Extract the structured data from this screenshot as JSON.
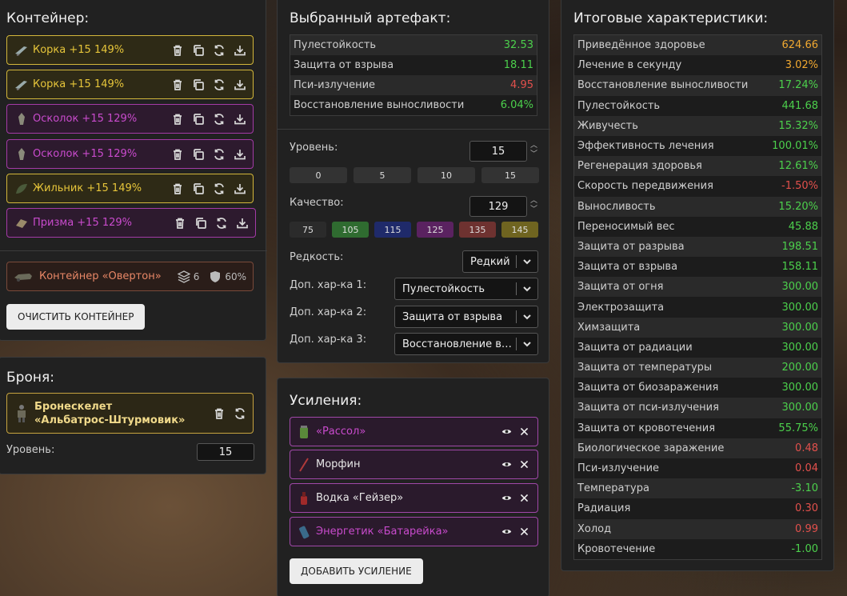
{
  "container": {
    "title": "Контейнер:",
    "items": [
      {
        "label": "Корка +15 149%",
        "color": "gold",
        "icon": "knife-icon"
      },
      {
        "label": "Корка +15 149%",
        "color": "gold",
        "icon": "knife-icon"
      },
      {
        "label": "Осколок +15 129%",
        "color": "purple",
        "icon": "shard-icon"
      },
      {
        "label": "Осколок +15 129%",
        "color": "purple",
        "icon": "shard-icon"
      },
      {
        "label": "Жильник +15 149%",
        "color": "gold",
        "icon": "leaf-icon"
      },
      {
        "label": "Призма +15 129%",
        "color": "purple",
        "icon": "prism-icon"
      }
    ],
    "container_name": "Контейнер «Овертон»",
    "slots": "6",
    "protection": "60%",
    "clear_button": "ОЧИСТИТЬ КОНТЕЙНЕР"
  },
  "armor": {
    "title": "Броня:",
    "name": "Бронескелет «Альбатрос-Штурмовик»",
    "level_label": "Уровень:",
    "level_value": "15"
  },
  "artifact": {
    "title": "Выбранный артефакт:",
    "stats": [
      {
        "name": "Пулестойкость",
        "value": "32.53",
        "tone": "green"
      },
      {
        "name": "Защита от взрыва",
        "value": "18.11",
        "tone": "green"
      },
      {
        "name": "Пси-излучение",
        "value": "4.95",
        "tone": "red"
      },
      {
        "name": "Восстановление выносливости",
        "value": "6.04%",
        "tone": "green"
      }
    ],
    "level_label": "Уровень:",
    "level_value": "15",
    "level_presets": [
      "0",
      "5",
      "10",
      "15"
    ],
    "quality_label": "Качество:",
    "quality_value": "129",
    "quality_presets": [
      {
        "label": "75",
        "color": "#2b2b2b"
      },
      {
        "label": "105",
        "color": "#2f6b30"
      },
      {
        "label": "115",
        "color": "#1f2a6a"
      },
      {
        "label": "125",
        "color": "#5a2260"
      },
      {
        "label": "135",
        "color": "#6e3230"
      },
      {
        "label": "145",
        "color": "#6f6420"
      }
    ],
    "rarity_label": "Редкость:",
    "rarity_value": "Редкий",
    "extra1_label": "Доп. хар-ка 1:",
    "extra1_value": "Пулестойкость",
    "extra2_label": "Доп. хар-ка 2:",
    "extra2_value": "Защита от взрыва",
    "extra3_label": "Доп. хар-ка 3:",
    "extra3_value": "Восстановление выносливости"
  },
  "boosts": {
    "title": "Усиления:",
    "items": [
      {
        "label": "«Рассол»",
        "color": "#c94bcd",
        "icon": "jar-icon"
      },
      {
        "label": "Морфин",
        "color": "#e8e8e8",
        "icon": "syringe-icon"
      },
      {
        "label": "Водка «Гейзер»",
        "color": "#e8e8e8",
        "icon": "bottle-icon"
      },
      {
        "label": "Энергетик «Батарейка»",
        "color": "#c94bcd",
        "icon": "can-icon"
      }
    ],
    "add_button": "ДОБАВИТЬ УСИЛЕНИЕ"
  },
  "totals": {
    "title": "Итоговые характеристики:",
    "rows": [
      {
        "name": "Приведённое здоровье",
        "value": "624.66",
        "tone": "orange"
      },
      {
        "name": "Лечение в секунду",
        "value": "3.02%",
        "tone": "orange"
      },
      {
        "name": "Восстановление выносливости",
        "value": "17.24%",
        "tone": "green"
      },
      {
        "name": "Пулестойкость",
        "value": "441.68",
        "tone": "green"
      },
      {
        "name": "Живучесть",
        "value": "15.32%",
        "tone": "green"
      },
      {
        "name": "Эффективность лечения",
        "value": "100.01%",
        "tone": "green"
      },
      {
        "name": "Регенерация здоровья",
        "value": "12.61%",
        "tone": "green"
      },
      {
        "name": "Скорость передвижения",
        "value": "-1.50%",
        "tone": "red"
      },
      {
        "name": "Выносливость",
        "value": "15.20%",
        "tone": "green"
      },
      {
        "name": "Переносимый вес",
        "value": "45.88",
        "tone": "green"
      },
      {
        "name": "Защита от разрыва",
        "value": "198.51",
        "tone": "green"
      },
      {
        "name": "Защита от взрыва",
        "value": "158.11",
        "tone": "green"
      },
      {
        "name": "Защита от огня",
        "value": "300.00",
        "tone": "green"
      },
      {
        "name": "Электрозащита",
        "value": "300.00",
        "tone": "green"
      },
      {
        "name": "Химзащита",
        "value": "300.00",
        "tone": "green"
      },
      {
        "name": "Защита от радиации",
        "value": "300.00",
        "tone": "green"
      },
      {
        "name": "Защита от температуры",
        "value": "200.00",
        "tone": "green"
      },
      {
        "name": "Защита от биозаражения",
        "value": "300.00",
        "tone": "green"
      },
      {
        "name": "Защита от пси-излучения",
        "value": "300.00",
        "tone": "green"
      },
      {
        "name": "Защита от кровотечения",
        "value": "55.75%",
        "tone": "green"
      },
      {
        "name": "Биологическое заражение",
        "value": "0.48",
        "tone": "red"
      },
      {
        "name": "Пси-излучение",
        "value": "0.04",
        "tone": "red"
      },
      {
        "name": "Температура",
        "value": "-3.10",
        "tone": "green"
      },
      {
        "name": "Радиация",
        "value": "0.30",
        "tone": "red"
      },
      {
        "name": "Холод",
        "value": "0.99",
        "tone": "red"
      },
      {
        "name": "Кровотечение",
        "value": "-1.00",
        "tone": "green"
      }
    ]
  }
}
